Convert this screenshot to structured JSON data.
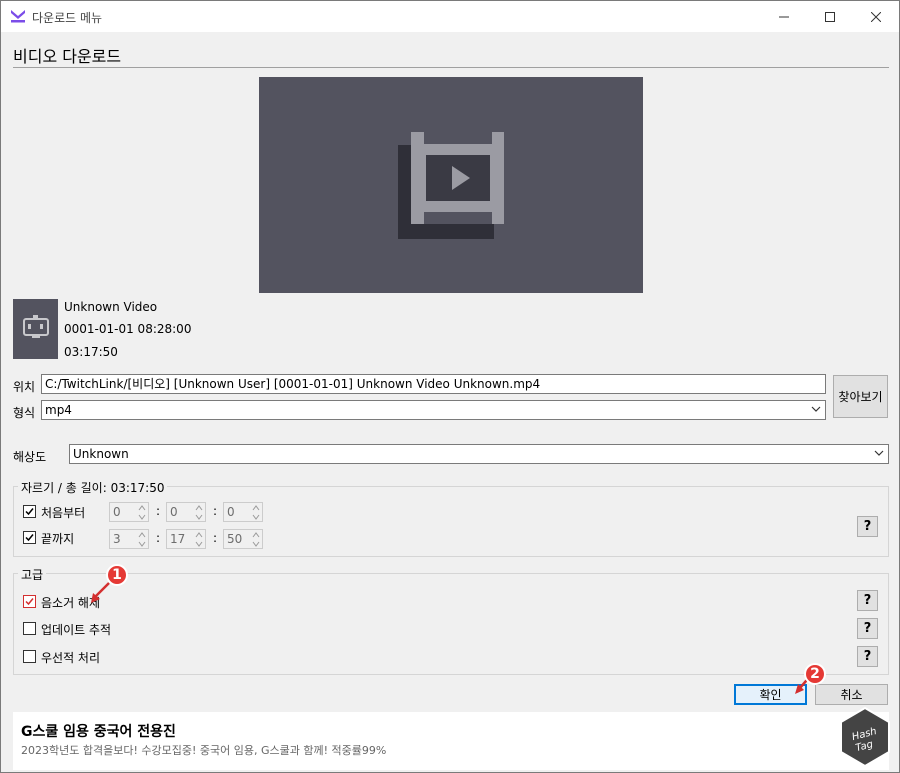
{
  "window": {
    "title": "다운로드 메뉴",
    "accent": "#7b4de8"
  },
  "header": {
    "title": "비디오 다운로드"
  },
  "video": {
    "title": "Unknown Video",
    "date": "0001-01-01 08:28:00",
    "length": "03:17:50"
  },
  "location": {
    "label": "위치",
    "path": "C:/TwitchLink/[비디오] [Unknown User] [0001-01-01] Unknown Video Unknown.mp4",
    "browse_label": "찾아보기"
  },
  "format": {
    "label": "형식",
    "value": "mp4"
  },
  "resolution": {
    "label": "해상도",
    "value": "Unknown"
  },
  "trim": {
    "title": "자르기 / 총 길이: 03:17:50",
    "from_start_label": "처음부터",
    "to_end_label": "끝까지",
    "start": {
      "h": "0",
      "m": "0",
      "s": "0"
    },
    "end": {
      "h": "3",
      "m": "17",
      "s": "50"
    },
    "help": "?"
  },
  "advanced": {
    "title": "고급",
    "options": [
      {
        "label": "음소거 해제",
        "checked": true
      },
      {
        "label": "업데이트 추적",
        "checked": false
      },
      {
        "label": "우선적 처리",
        "checked": false
      }
    ],
    "help": "?"
  },
  "buttons": {
    "ok": "확인",
    "cancel": "취소"
  },
  "annotations": {
    "badge1": "1",
    "badge2": "2"
  },
  "ad": {
    "title": "G스쿨 임용 중국어 전용진",
    "desc": "2023학년도 합격을보다! 수강모집중! 중국어 임용, G스쿨과 함께! 적중률99%"
  },
  "watermark": {
    "line1": "Hash",
    "line2": "Tag"
  }
}
